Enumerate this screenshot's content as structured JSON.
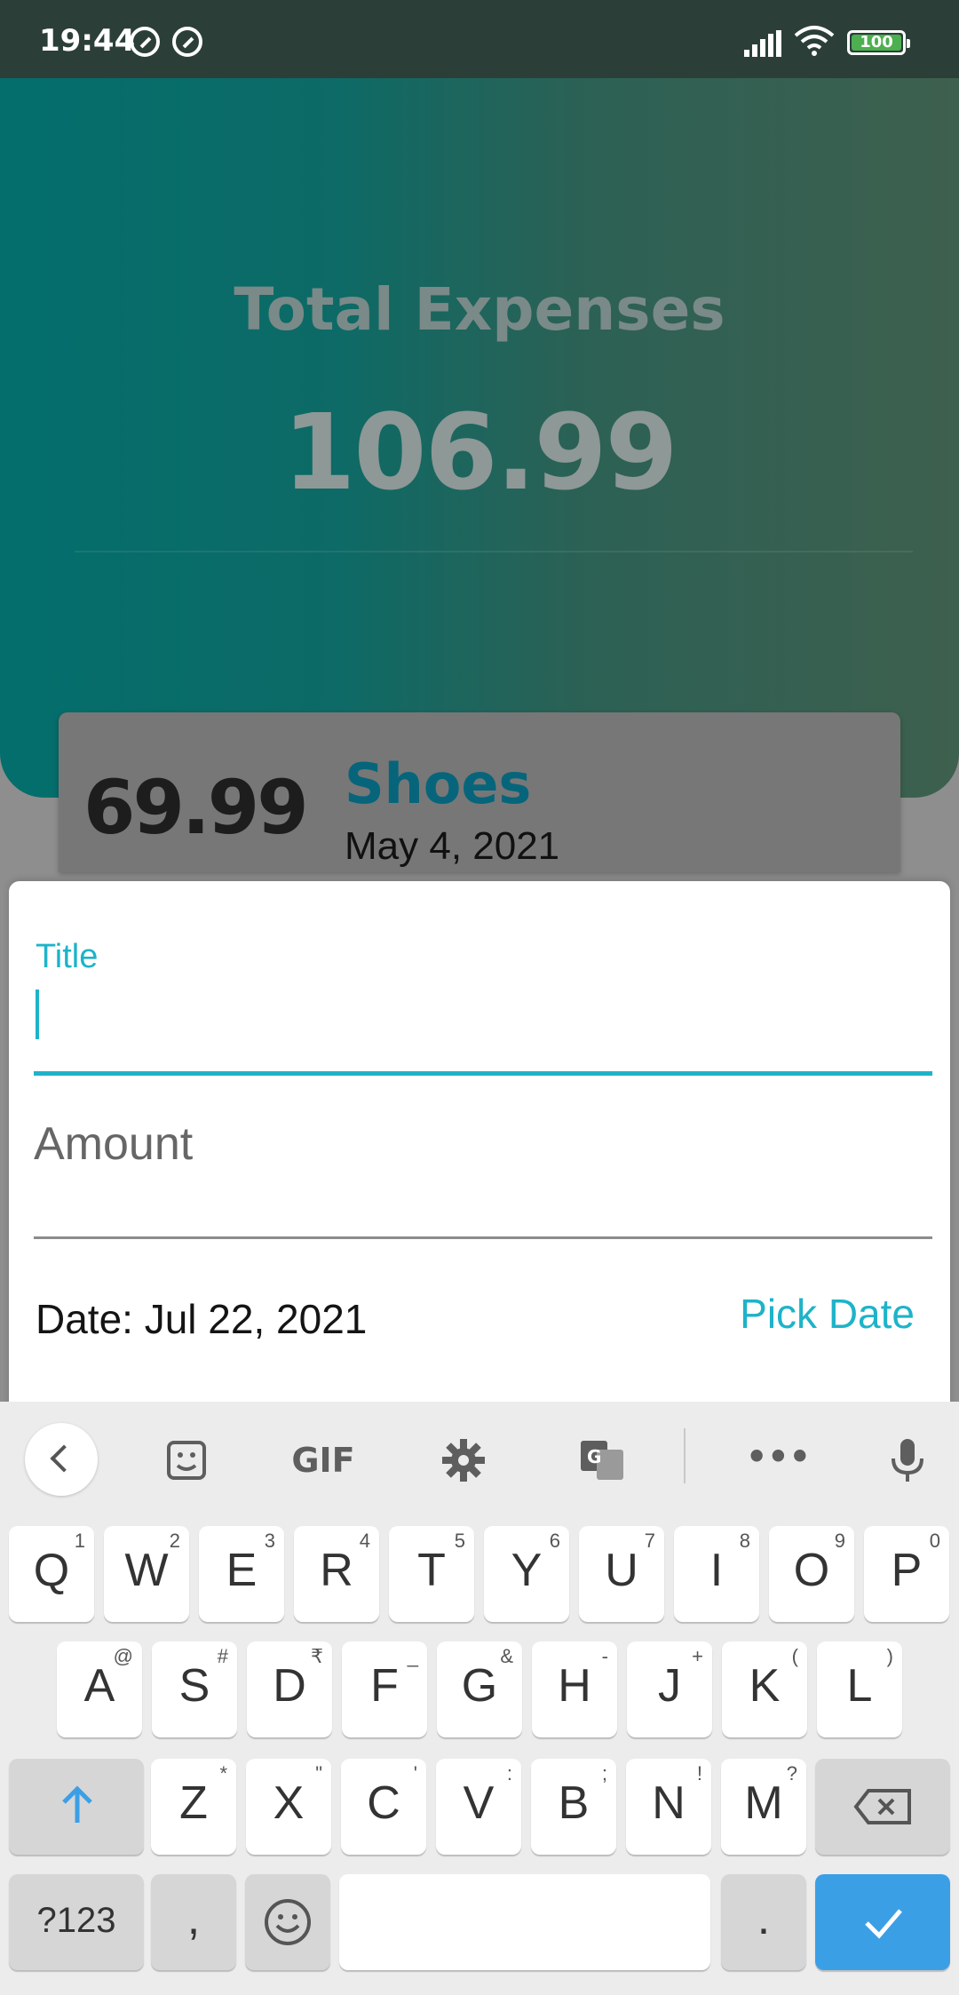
{
  "status_bar": {
    "time": "19:44",
    "battery": "100"
  },
  "header": {
    "title": "Total Expenses",
    "total": "106.99"
  },
  "expense_item": {
    "amount": "69.99",
    "title": "Shoes",
    "date": "May 4, 2021"
  },
  "form": {
    "title_label": "Title",
    "amount_placeholder": "Amount",
    "date_text": "Date: Jul 22, 2021",
    "pick_date_label": "Pick Date"
  },
  "keyboard": {
    "toolbar": {
      "gif_label": "GIF",
      "more_label": "•••"
    },
    "row1": [
      {
        "k": "Q",
        "h": "1"
      },
      {
        "k": "W",
        "h": "2"
      },
      {
        "k": "E",
        "h": "3"
      },
      {
        "k": "R",
        "h": "4"
      },
      {
        "k": "T",
        "h": "5"
      },
      {
        "k": "Y",
        "h": "6"
      },
      {
        "k": "U",
        "h": "7"
      },
      {
        "k": "I",
        "h": "8"
      },
      {
        "k": "O",
        "h": "9"
      },
      {
        "k": "P",
        "h": "0"
      }
    ],
    "row2": [
      {
        "k": "A",
        "h": "@"
      },
      {
        "k": "S",
        "h": "#"
      },
      {
        "k": "D",
        "h": "₹"
      },
      {
        "k": "F",
        "h": "_"
      },
      {
        "k": "G",
        "h": "&"
      },
      {
        "k": "H",
        "h": "-"
      },
      {
        "k": "J",
        "h": "+"
      },
      {
        "k": "K",
        "h": "("
      },
      {
        "k": "L",
        "h": ")"
      }
    ],
    "row3": [
      {
        "k": "Z",
        "h": "*"
      },
      {
        "k": "X",
        "h": "\""
      },
      {
        "k": "C",
        "h": "'"
      },
      {
        "k": "V",
        "h": ":"
      },
      {
        "k": "B",
        "h": ";"
      },
      {
        "k": "N",
        "h": "!"
      },
      {
        "k": "M",
        "h": "?"
      }
    ],
    "symbols_label": "?123",
    "comma_label": ",",
    "period_label": "."
  },
  "colors": {
    "accent": "#1eb3c9",
    "brand_title": "#06657b",
    "keyboard_accent": "#3b9fe6"
  }
}
